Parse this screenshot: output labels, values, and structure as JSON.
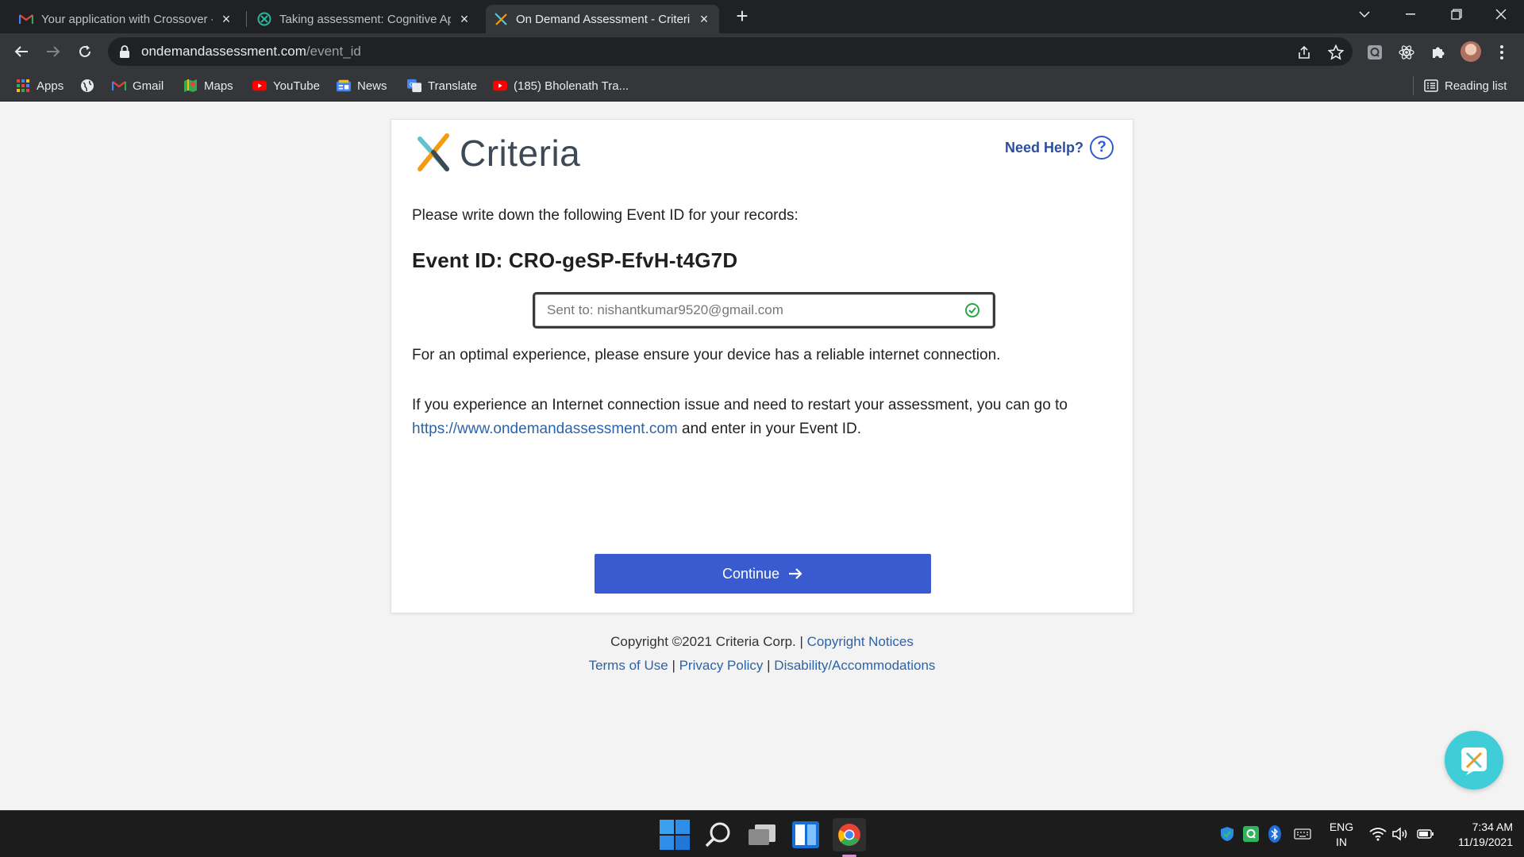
{
  "browser": {
    "tabs": [
      {
        "title": "Your application with Crossover -",
        "icon": "gmail-icon"
      },
      {
        "title": "Taking assessment: Cognitive Apt",
        "icon": "crossover-icon"
      },
      {
        "title": "On Demand Assessment - Criteri",
        "icon": "criteria-icon",
        "active": true
      }
    ],
    "address": {
      "domain": "ondemandassessment.com",
      "path": "/event_id"
    },
    "bookmarks": [
      {
        "label": "Apps",
        "icon": "apps-grid-icon"
      },
      {
        "label": "",
        "icon": "globe-icon"
      },
      {
        "label": "Gmail",
        "icon": "gmail-icon"
      },
      {
        "label": "Maps",
        "icon": "maps-icon"
      },
      {
        "label": "YouTube",
        "icon": "youtube-icon"
      },
      {
        "label": "News",
        "icon": "google-news-icon"
      },
      {
        "label": "Translate",
        "icon": "translate-icon"
      },
      {
        "label": "(185) Bholenath Tra...",
        "icon": "youtube-icon"
      }
    ],
    "reading_list": "Reading list"
  },
  "page": {
    "logo_text": "Criteria",
    "help_label": "Need Help?",
    "intro": "Please write down the following Event ID for your records:",
    "event_id": "Event ID: CRO-geSP-EfvH-t4G7D",
    "sent_to": "Sent to: nishantkumar9520@gmail.com",
    "optimal": "For an optimal experience, please ensure your device has a reliable internet connection.",
    "issue_text": "If you experience an Internet connection issue and need to restart your assessment, you can go to",
    "issue_link": "https://www.ondemandassessment.com",
    "issue_tail": "and enter in your Event ID.",
    "continue_label": "Continue"
  },
  "footer": {
    "copyright": "Copyright ©2021 Criteria Corp. |",
    "copyright_link": "Copyright Notices",
    "terms": "Terms of Use",
    "sep": "|",
    "privacy": "Privacy Policy",
    "disability": "Disability/Accommodations"
  },
  "taskbar": {
    "lang_line1": "ENG",
    "lang_line2": "IN",
    "time": "7:34 AM",
    "date": "11/19/2021"
  },
  "colors": {
    "accent_blue": "#3a5bcf",
    "link_blue": "#2d63a8",
    "fab_teal": "#3fcdd8",
    "success_green": "#27a844"
  }
}
